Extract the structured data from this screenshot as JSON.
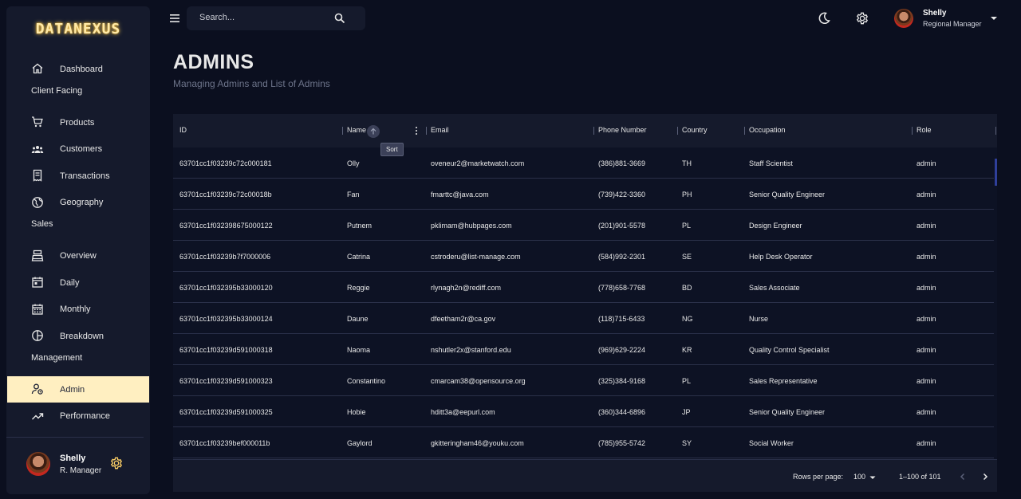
{
  "brand": {
    "logo": "DATANEXUS"
  },
  "search": {
    "placeholder": "Search..."
  },
  "user": {
    "name": "Shelly",
    "occupation": "Regional Manager",
    "short_role": "R. Manager"
  },
  "sidebar": {
    "items": [
      {
        "type": "item",
        "label": "Dashboard",
        "icon": "home-icon"
      },
      {
        "type": "section",
        "label": "Client Facing"
      },
      {
        "type": "item",
        "label": "Products",
        "icon": "shopping-cart-icon"
      },
      {
        "type": "item",
        "label": "Customers",
        "icon": "groups-icon"
      },
      {
        "type": "item",
        "label": "Transactions",
        "icon": "receipt-icon"
      },
      {
        "type": "item",
        "label": "Geography",
        "icon": "globe-icon"
      },
      {
        "type": "section",
        "label": "Sales"
      },
      {
        "type": "item",
        "label": "Overview",
        "icon": "point-of-sale-icon"
      },
      {
        "type": "item",
        "label": "Daily",
        "icon": "calendar-today-icon"
      },
      {
        "type": "item",
        "label": "Monthly",
        "icon": "calendar-month-icon"
      },
      {
        "type": "item",
        "label": "Breakdown",
        "icon": "pie-chart-icon"
      },
      {
        "type": "section",
        "label": "Management"
      },
      {
        "type": "item",
        "label": "Admin",
        "icon": "admin-settings-icon",
        "active": true
      },
      {
        "type": "item",
        "label": "Performance",
        "icon": "trending-up-icon"
      }
    ]
  },
  "header": {
    "title": "ADMINS",
    "subtitle": "Managing Admins and List of Admins"
  },
  "table": {
    "columns": [
      "ID",
      "Name",
      "Email",
      "Phone Number",
      "Country",
      "Occupation",
      "Role"
    ],
    "sort_tooltip": "Sort",
    "rows": [
      [
        "63701cc1f03239c72c000181",
        "Olly",
        "oveneur2@marketwatch.com",
        "(386)881-3669",
        "TH",
        "Staff Scientist",
        "admin"
      ],
      [
        "63701cc1f03239c72c00018b",
        "Fan",
        "fmarttc@java.com",
        "(739)422-3360",
        "PH",
        "Senior Quality Engineer",
        "admin"
      ],
      [
        "63701cc1f032398675000122",
        "Putnem",
        "pklimam@hubpages.com",
        "(201)901-5578",
        "PL",
        "Design Engineer",
        "admin"
      ],
      [
        "63701cc1f03239b7f7000006",
        "Catrina",
        "cstroderu@list-manage.com",
        "(584)992-2301",
        "SE",
        "Help Desk Operator",
        "admin"
      ],
      [
        "63701cc1f032395b33000120",
        "Reggie",
        "rlynagh2n@rediff.com",
        "(778)658-7768",
        "BD",
        "Sales Associate",
        "admin"
      ],
      [
        "63701cc1f032395b33000124",
        "Daune",
        "dfeetham2r@ca.gov",
        "(118)715-6433",
        "NG",
        "Nurse",
        "admin"
      ],
      [
        "63701cc1f03239d591000318",
        "Naoma",
        "nshutler2x@stanford.edu",
        "(969)629-2224",
        "KR",
        "Quality Control Specialist",
        "admin"
      ],
      [
        "63701cc1f03239d591000323",
        "Constantino",
        "cmarcam38@opensource.org",
        "(325)384-9168",
        "PL",
        "Sales Representative",
        "admin"
      ],
      [
        "63701cc1f03239d591000325",
        "Hobie",
        "hditt3a@eepurl.com",
        "(360)344-6896",
        "JP",
        "Senior Quality Engineer",
        "admin"
      ],
      [
        "63701cc1f03239bef000011b",
        "Gaylord",
        "gkitteringham46@youku.com",
        "(785)955-5742",
        "SY",
        "Social Worker",
        "admin"
      ]
    ]
  },
  "pagination": {
    "rows_per_page_label": "Rows per page:",
    "rows_per_page": "100",
    "range": "1–100 of 101"
  },
  "colors": {
    "background": "#0b0f1f",
    "panel": "#151a2c",
    "accent": "#ffefc1",
    "logo": "#ffd166"
  }
}
